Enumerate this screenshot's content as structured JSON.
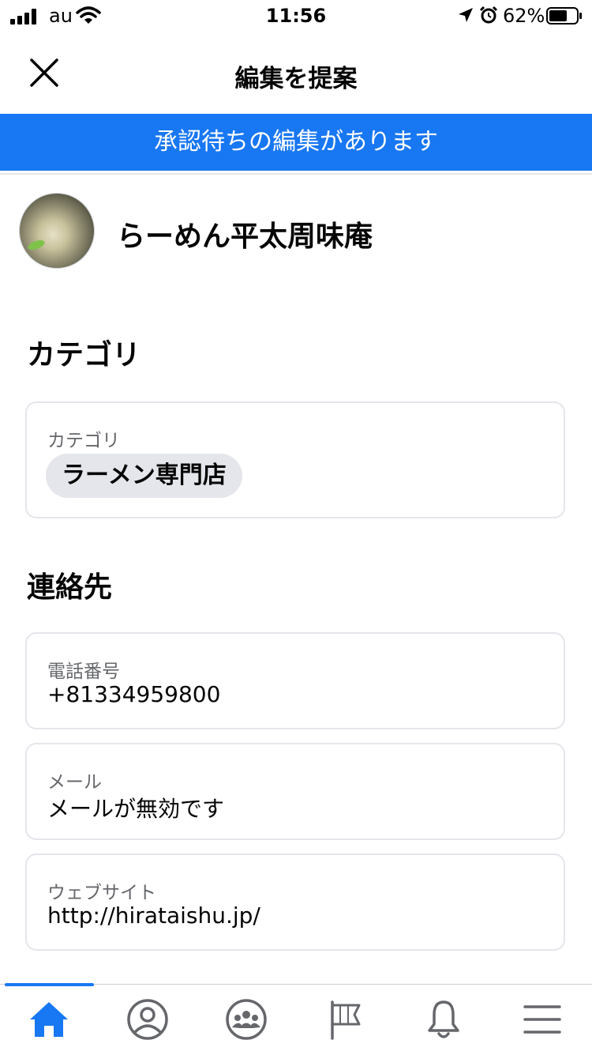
{
  "status_bar": {
    "carrier": "au",
    "time": "11:56",
    "battery": "62%"
  },
  "header": {
    "title": "編集を提案",
    "close_icon": "close-icon"
  },
  "banner": {
    "text": "承認待ちの編集があります",
    "color": "#1877f2"
  },
  "place": {
    "name": "らーめん平太周味庵"
  },
  "sections": {
    "category_title": "カテゴリ",
    "contact_title": "連絡先"
  },
  "category_field": {
    "label": "カテゴリ",
    "chip": "ラーメン専門店"
  },
  "contact_fields": {
    "phone": {
      "label": "電話番号",
      "value": "+81334959800"
    },
    "email": {
      "label": "メール",
      "value": "メールが無効です"
    },
    "website": {
      "label": "ウェブサイト",
      "value": "http://hirataishu.jp/"
    }
  },
  "bottom_nav": {
    "active_color": "#1877f2",
    "items": [
      "home-icon",
      "profile-icon",
      "groups-icon",
      "pages-flag-icon",
      "notifications-bell-icon",
      "menu-icon"
    ]
  }
}
